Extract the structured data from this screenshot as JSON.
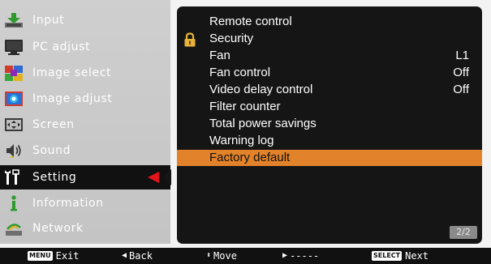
{
  "sidebar": {
    "items": [
      {
        "label": "Input",
        "icon": "input-icon"
      },
      {
        "label": "PC adjust",
        "icon": "pc-adjust-icon"
      },
      {
        "label": "Image select",
        "icon": "image-select-icon"
      },
      {
        "label": "Image adjust",
        "icon": "image-adjust-icon"
      },
      {
        "label": "Screen",
        "icon": "screen-icon"
      },
      {
        "label": "Sound",
        "icon": "sound-icon"
      },
      {
        "label": "Setting",
        "icon": "setting-icon",
        "active": true
      },
      {
        "label": "Information",
        "icon": "information-icon"
      },
      {
        "label": "Network",
        "icon": "network-icon"
      }
    ]
  },
  "panel": {
    "rows": [
      {
        "label": "Remote control",
        "value": ""
      },
      {
        "label": "Security",
        "value": "",
        "icon": "lock-icon"
      },
      {
        "label": "Fan",
        "value": "L1"
      },
      {
        "label": "Fan control",
        "value": "Off"
      },
      {
        "label": "Video delay control",
        "value": "Off"
      },
      {
        "label": "Filter counter",
        "value": ""
      },
      {
        "label": "Total power savings",
        "value": ""
      },
      {
        "label": "Warning log",
        "value": ""
      },
      {
        "label": "Factory default",
        "value": "",
        "selected": true
      }
    ],
    "page": "2/2"
  },
  "bottombar": {
    "exit_key": "MENU",
    "exit_label": "Exit",
    "back_label": "Back",
    "move_label": "Move",
    "next_dashes": "-----",
    "next_key": "SELECT",
    "next_label": "Next"
  },
  "colors": {
    "sidebar_bg": "#c8c8c8",
    "panel_bg": "#151515",
    "highlight": "#e2822a",
    "active_arrow": "#e4141a",
    "bottombar_bg": "#111111"
  }
}
